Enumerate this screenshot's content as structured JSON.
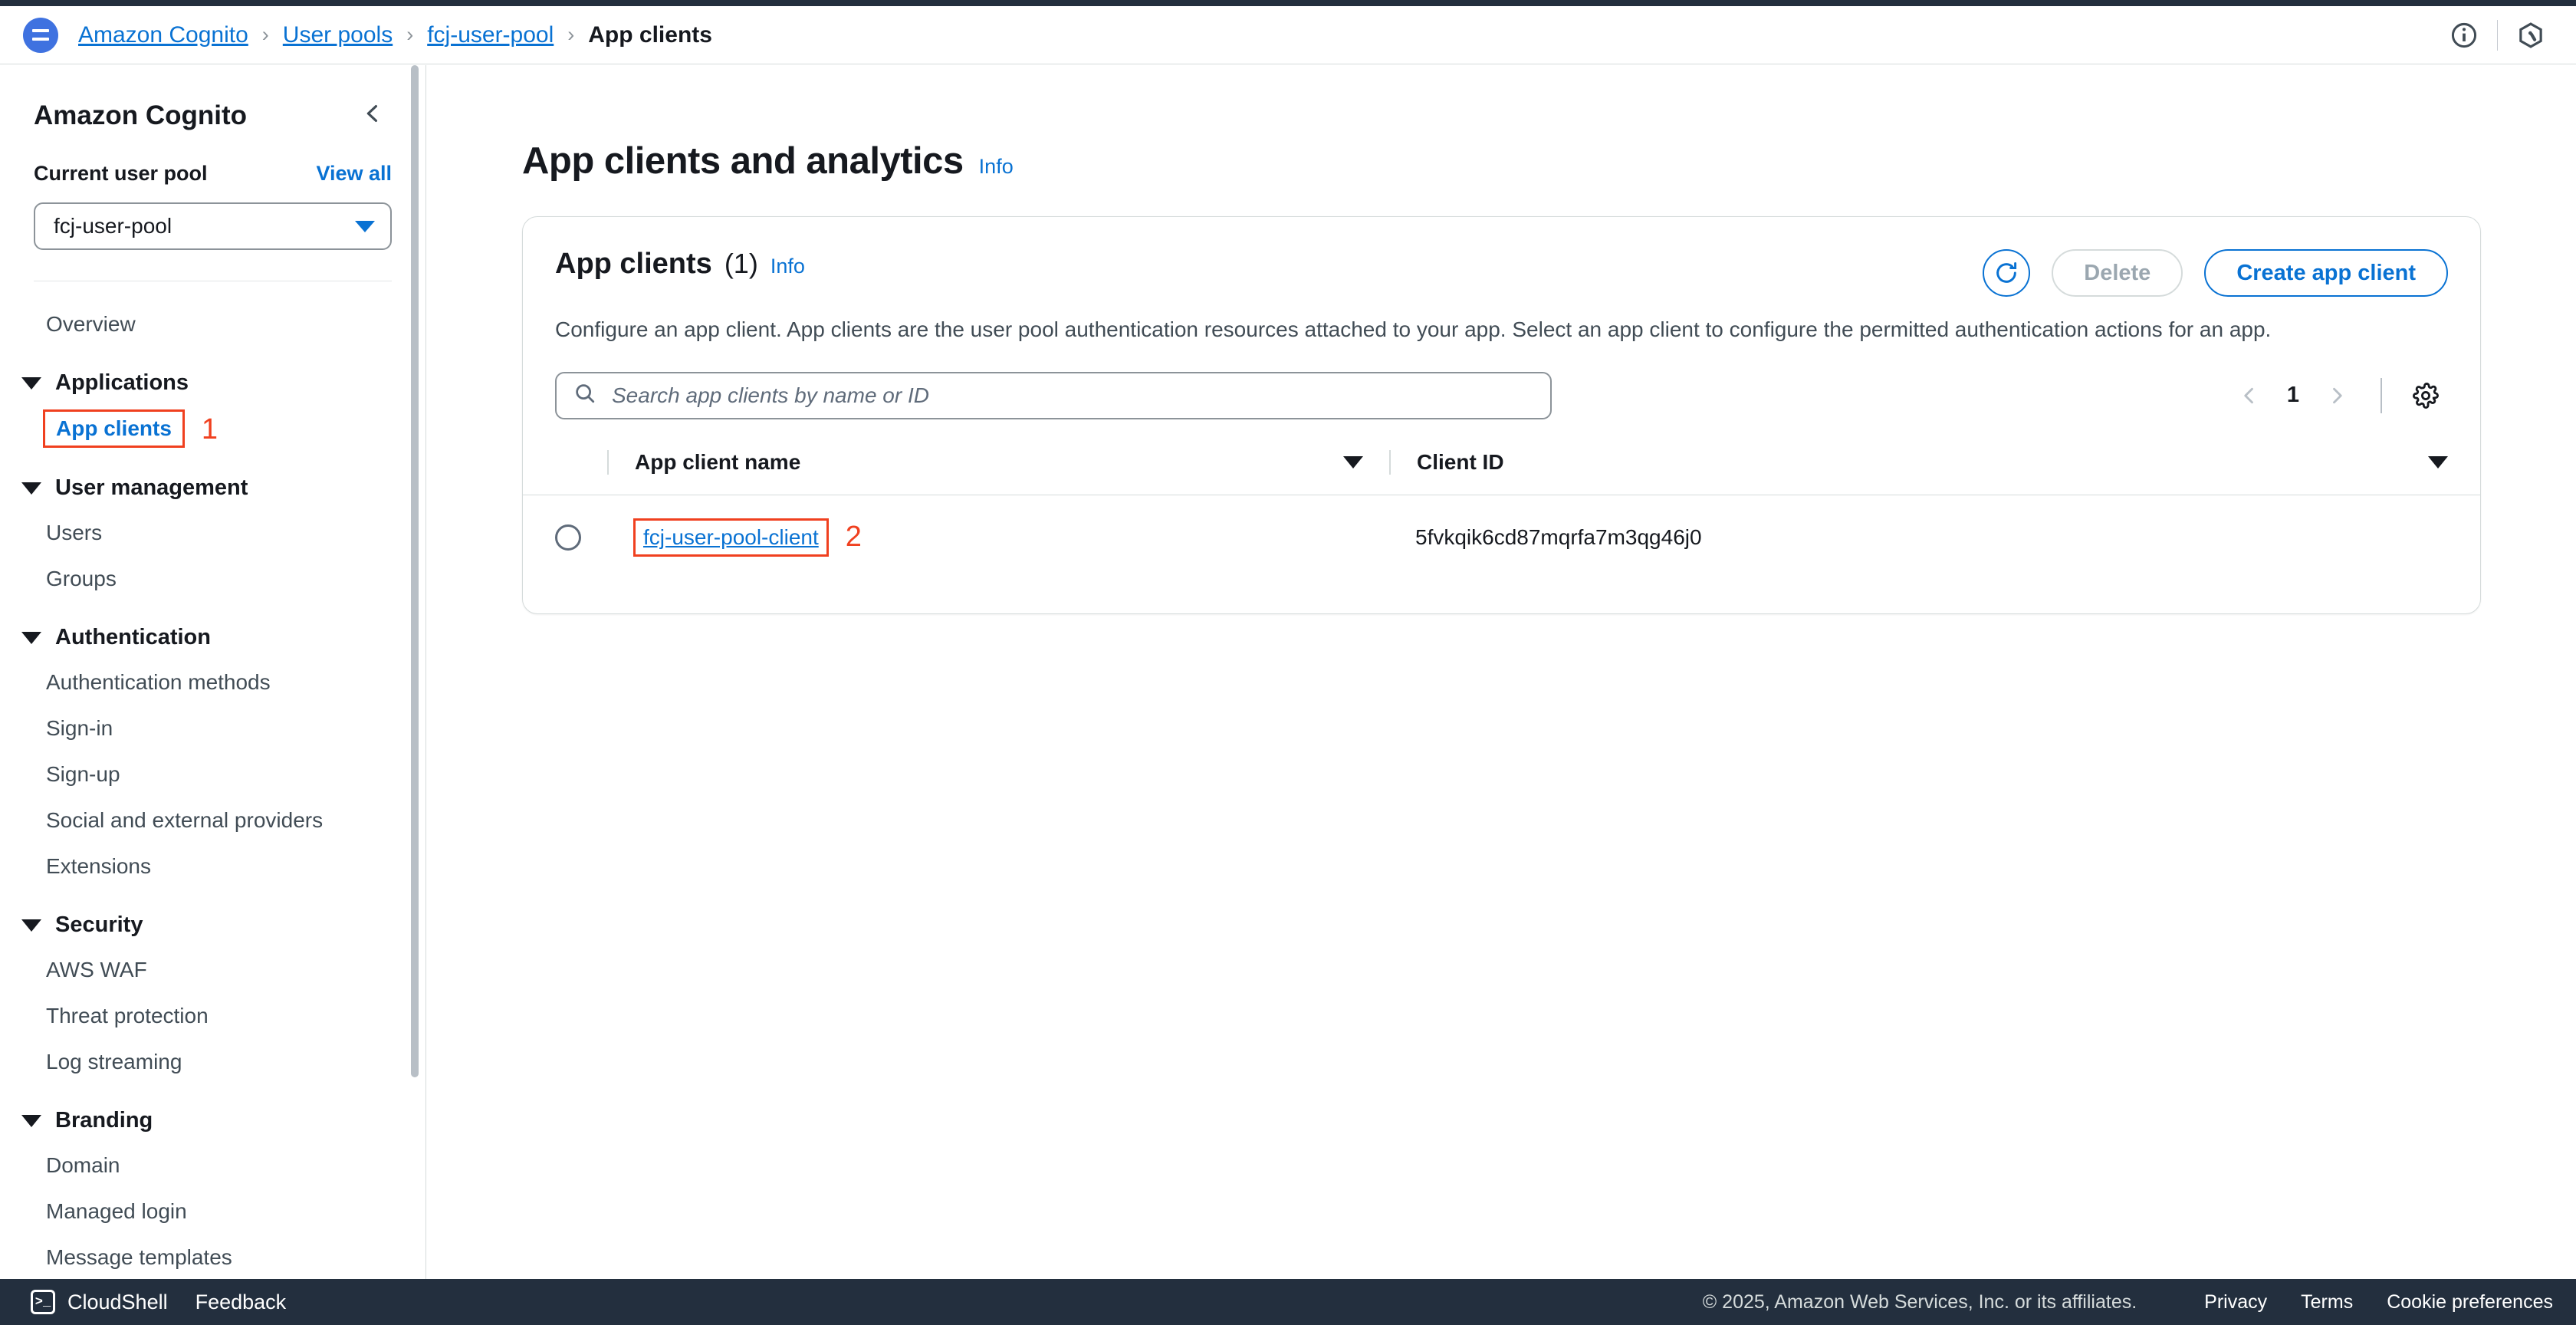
{
  "header": {
    "menu_icon": "hamburger-icon",
    "breadcrumb": [
      {
        "label": "Amazon Cognito",
        "type": "link"
      },
      {
        "label": "User pools",
        "type": "link"
      },
      {
        "label": "fcj-user-pool",
        "type": "link"
      },
      {
        "label": "App clients",
        "type": "current"
      }
    ],
    "separator": "›",
    "icons": [
      {
        "name": "info-circle-icon",
        "glyph": "ⓘ"
      },
      {
        "name": "amazon-q-icon",
        "glyph": "Q"
      }
    ]
  },
  "sidebar": {
    "title": "Amazon Cognito",
    "collapse_icon": "chevron-left-icon",
    "collapse_glyph": "‹",
    "current_pool_label": "Current user pool",
    "view_all_label": "View all",
    "pool_select_value": "fcj-user-pool",
    "nav": [
      {
        "type": "item",
        "label": "Overview",
        "selected": false
      },
      {
        "type": "group",
        "label": "Applications"
      },
      {
        "type": "item",
        "label": "App clients",
        "selected": true,
        "annotation": "1"
      },
      {
        "type": "group",
        "label": "User management"
      },
      {
        "type": "item",
        "label": "Users",
        "selected": false
      },
      {
        "type": "item",
        "label": "Groups",
        "selected": false
      },
      {
        "type": "group",
        "label": "Authentication"
      },
      {
        "type": "item",
        "label": "Authentication methods",
        "selected": false
      },
      {
        "type": "item",
        "label": "Sign-in",
        "selected": false
      },
      {
        "type": "item",
        "label": "Sign-up",
        "selected": false
      },
      {
        "type": "item",
        "label": "Social and external providers",
        "selected": false
      },
      {
        "type": "item",
        "label": "Extensions",
        "selected": false
      },
      {
        "type": "group",
        "label": "Security"
      },
      {
        "type": "item",
        "label": "AWS WAF",
        "selected": false
      },
      {
        "type": "item",
        "label": "Threat protection",
        "selected": false
      },
      {
        "type": "item",
        "label": "Log streaming",
        "selected": false
      },
      {
        "type": "group",
        "label": "Branding"
      },
      {
        "type": "item",
        "label": "Domain",
        "selected": false
      },
      {
        "type": "item",
        "label": "Managed login",
        "selected": false
      },
      {
        "type": "item",
        "label": "Message templates",
        "selected": false
      }
    ]
  },
  "main": {
    "page_title": "App clients and analytics",
    "page_info_label": "Info",
    "card": {
      "title": "App clients",
      "count": "(1)",
      "info_label": "Info",
      "description": "Configure an app client. App clients are the user pool authentication resources attached to your app. Select an app client to configure the permitted authentication actions for an app.",
      "refresh_icon": "refresh-icon",
      "delete_label": "Delete",
      "create_label": "Create app client",
      "search_placeholder": "Search app clients by name or ID",
      "search_value": "",
      "search_icon": "search-icon",
      "pagination": {
        "prev_icon": "chevron-left-icon",
        "next_icon": "chevron-right-icon",
        "current_page": "1"
      },
      "settings_icon": "gear-icon",
      "table": {
        "columns": [
          "App client name",
          "Client ID"
        ],
        "rows": [
          {
            "app_client_name": "fcj-user-pool-client",
            "client_id": "5fvkqik6cd87mqrfa7m3qg46j0",
            "annotation": "2",
            "selected": false
          }
        ]
      }
    }
  },
  "footer": {
    "cloudshell_label": "CloudShell",
    "cloudshell_icon": "terminal-icon",
    "feedback_label": "Feedback",
    "copyright": "© 2025, Amazon Web Services, Inc. or its affiliates.",
    "links": [
      "Privacy",
      "Terms",
      "Cookie preferences"
    ]
  },
  "colors": {
    "accent_blue": "#0972d3",
    "annotation_red": "#f0401f",
    "navy": "#232f3e",
    "text_dark": "#16191f",
    "text_muted": "#414c55"
  }
}
